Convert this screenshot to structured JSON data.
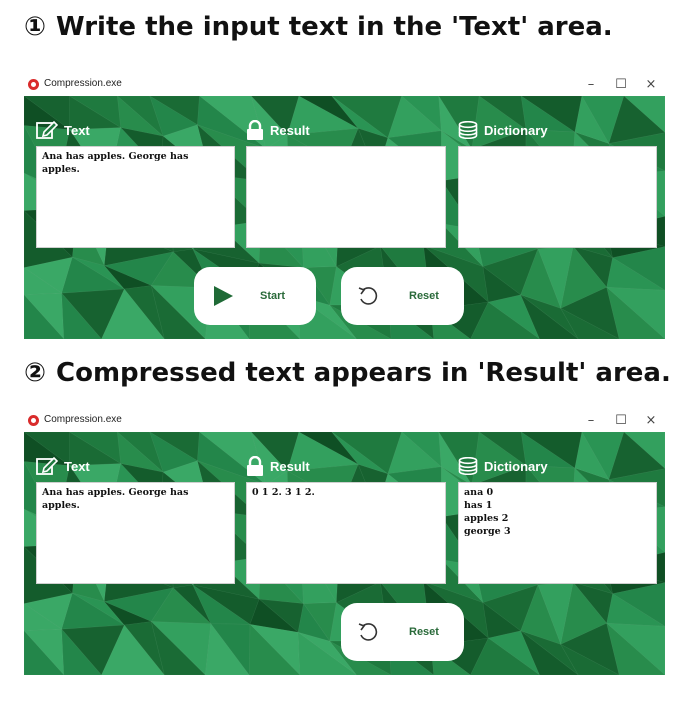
{
  "step1": {
    "number": "①",
    "text": "Write the input text in the 'Text' area."
  },
  "step2": {
    "number": "②",
    "text": "Compressed text appears in 'Result' area."
  },
  "window_title": "Compression.exe",
  "window_controls": {
    "minimize": "–",
    "maximize": "☐",
    "close": "×"
  },
  "labels": {
    "text": "Text",
    "result": "Result",
    "dictionary": "Dictionary"
  },
  "buttons": {
    "start": "Start",
    "reset": "Reset"
  },
  "screen1": {
    "text_value": "Ana has apples. George has apples.",
    "result_value": "",
    "dictionary_value": ""
  },
  "screen2": {
    "text_value": "Ana has apples. George has apples.",
    "result_value": "0 1 2. 3 1 2.",
    "dictionary_value": "ana 0\nhas 1\napples 2\ngeorge 3"
  },
  "colors": {
    "background_green": "#1f7a3f",
    "button_text": "#2a6a3a",
    "app_icon": "#d92b2b"
  },
  "icons": {
    "text": "pencil-edit-icon",
    "result": "lock-icon",
    "dictionary": "database-icon",
    "start": "play-icon",
    "reset": "undo-icon"
  }
}
